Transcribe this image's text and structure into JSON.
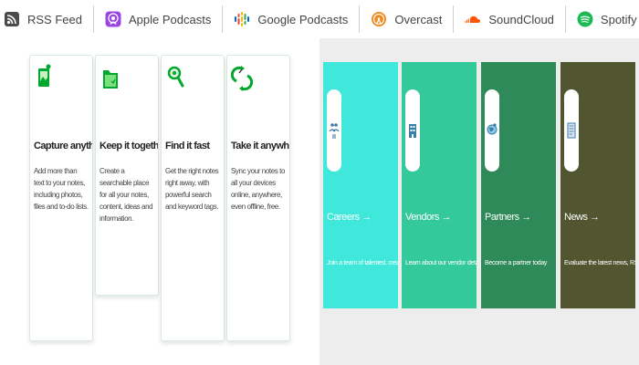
{
  "podcast_bar": {
    "links": [
      {
        "label": "RSS Feed",
        "icon": "rss-icon"
      },
      {
        "label": "Apple Podcasts",
        "icon": "apple-podcasts-icon",
        "color": "#8e3fd6"
      },
      {
        "label": "Google Podcasts",
        "icon": "google-podcasts-icon"
      },
      {
        "label": "Overcast",
        "icon": "overcast-icon",
        "color": "#f28a1e"
      },
      {
        "label": "SoundCloud",
        "icon": "soundcloud-icon",
        "color": "#ff5500"
      },
      {
        "label": "Spotify",
        "icon": "spotify-icon",
        "color": "#1db954"
      }
    ]
  },
  "features": [
    {
      "title": "Capture anything",
      "description": "Add more than text to your notes, including photos, files and to-do lists.",
      "icon": "phone-icon"
    },
    {
      "title": "Keep it together",
      "description": "Create a searchable place for all your notes, content, ideas and information.",
      "icon": "folder-icon"
    },
    {
      "title": "Find it fast",
      "description": "Get the right notes right away, with powerful search and keyword tags.",
      "icon": "magnifier-icon"
    },
    {
      "title": "Take it anywhere",
      "description": "Sync your notes to all your devices online, anywhere, even offline, free.",
      "icon": "sync-icon"
    }
  ],
  "categories": [
    {
      "title": "Careers →",
      "description": "Join a team of talented, creative people",
      "icon": "people-icon",
      "color": "#40e8dc"
    },
    {
      "title": "Vendors →",
      "description": "Learn about our vendor details",
      "icon": "building-icon",
      "color": "#33c99a"
    },
    {
      "title": "Partners →",
      "description": "Become a partner today",
      "icon": "globe-icon",
      "color": "#2e8a58"
    },
    {
      "title": "News →",
      "description": "Evaluate the latest news, RSS, and press",
      "icon": "document-icon",
      "color": "#515530"
    }
  ],
  "colors": {
    "accent_green": "#00a82d"
  }
}
